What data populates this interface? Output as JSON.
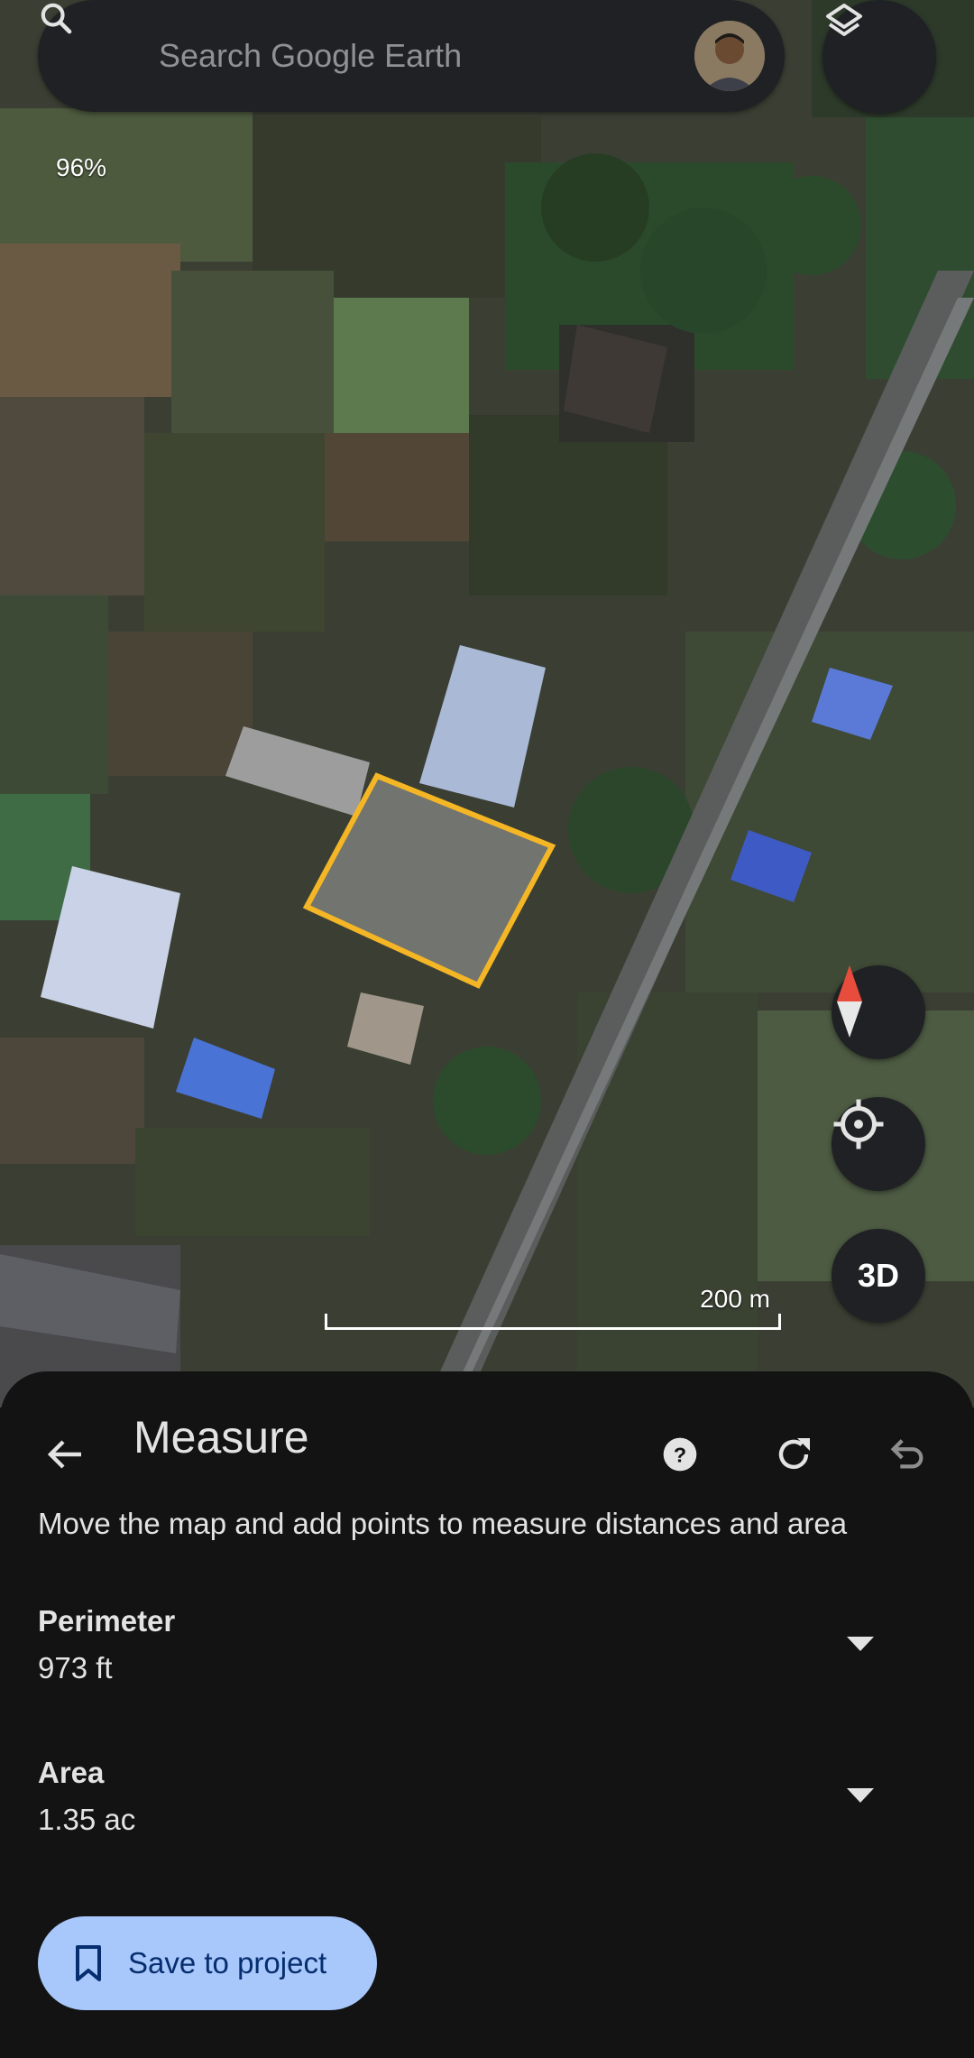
{
  "search": {
    "placeholder": "Search Google Earth",
    "icon": "search-icon"
  },
  "map": {
    "zoom_readout": "96%",
    "scale_label": "200 m",
    "measured_polygon_color": "#f5b626",
    "fab_3d_label": "3D",
    "icons": [
      "layers-icon",
      "compass-icon",
      "my-location-icon"
    ]
  },
  "sheet": {
    "title": "Measure",
    "instructions": "Move the map and add points to measure distances and area",
    "header_icons": [
      "back-arrow-icon",
      "help-icon",
      "reset-icon",
      "undo-icon"
    ],
    "measurements": [
      {
        "label": "Perimeter",
        "value": "973 ft"
      },
      {
        "label": "Area",
        "value": "1.35 ac"
      }
    ],
    "save_button_label": "Save to project",
    "accent_color": "#a8c7fa"
  }
}
